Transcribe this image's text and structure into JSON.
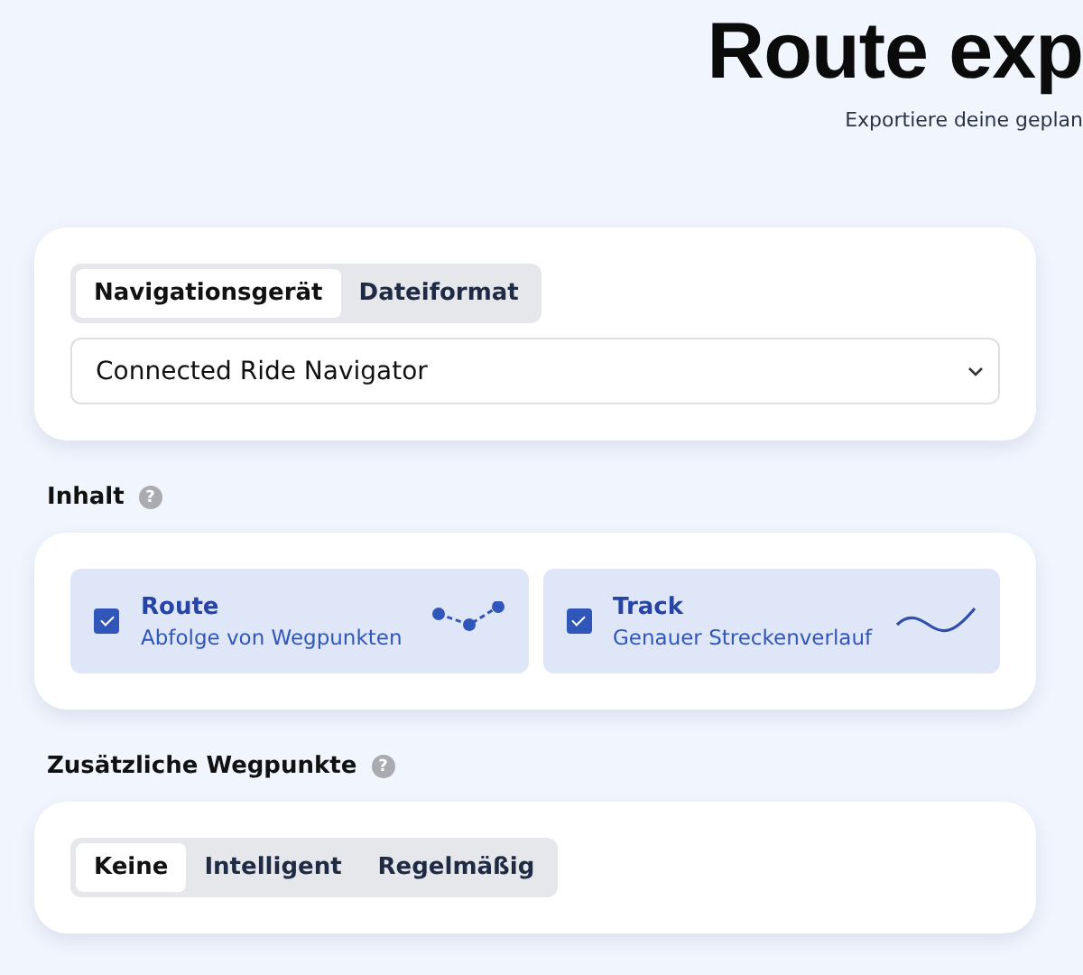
{
  "header": {
    "title": "Route exp",
    "subtitle": "Exportiere deine geplan"
  },
  "target": {
    "tabs": [
      {
        "label": "Navigationsgerät",
        "selected": true
      },
      {
        "label": "Dateiformat",
        "selected": false
      }
    ],
    "device_select": {
      "value": "Connected Ride Navigator"
    }
  },
  "content": {
    "label": "Inhalt",
    "help": "?",
    "options": [
      {
        "kind": "route",
        "title": "Route",
        "description": "Abfolge von Wegpunkten",
        "checked": true
      },
      {
        "kind": "track",
        "title": "Track",
        "description": "Genauer Streckenverlauf",
        "checked": true
      }
    ]
  },
  "waypoints": {
    "label": "Zusätzliche Wegpunkte",
    "help": "?",
    "choices": [
      {
        "label": "Keine",
        "selected": true
      },
      {
        "label": "Intelligent",
        "selected": false
      },
      {
        "label": "Regelmäßig",
        "selected": false
      }
    ]
  }
}
